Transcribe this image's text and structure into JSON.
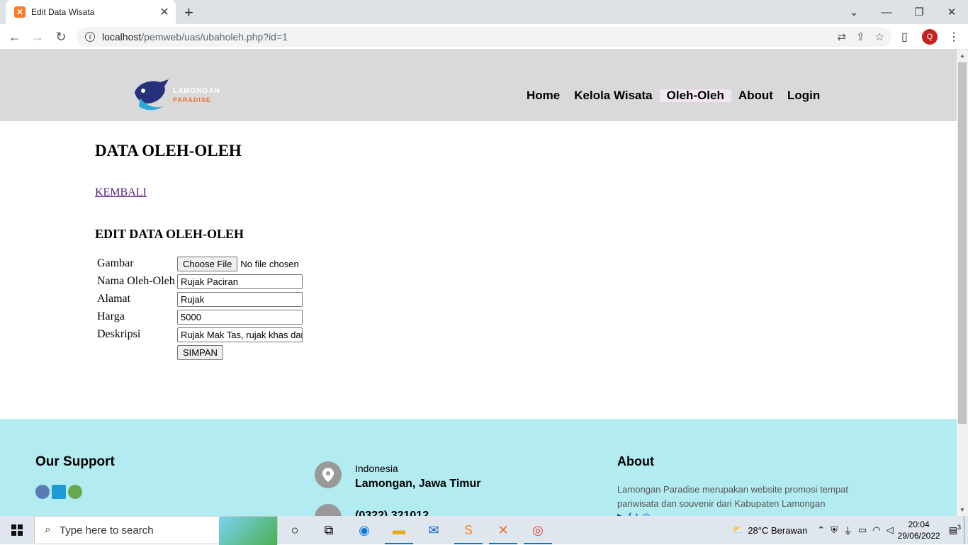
{
  "browser": {
    "tab_title": "Edit Data Wisata",
    "url_host": "localhost",
    "url_path": "/pemweb/uas/ubaholeh.php?id=1",
    "profile_initial": "Q"
  },
  "site": {
    "logo_line1": "LAMONGAN",
    "logo_line2": "PARADISE",
    "nav": [
      "Home",
      "Kelola Wisata",
      "Oleh-Oleh",
      "About",
      "Login"
    ],
    "active_nav": "Oleh-Oleh"
  },
  "page": {
    "heading": "DATA OLEH-OLEH",
    "back_link": "KEMBALI",
    "form_title": "EDIT DATA OLEH-OLEH",
    "form": {
      "gambar_label": "Gambar",
      "file_button": "Choose File",
      "file_status": "No file chosen",
      "nama_label": "Nama Oleh-Oleh",
      "nama_value": "Rujak Paciran",
      "alamat_label": "Alamat",
      "alamat_value": "Rujak",
      "harga_label": "Harga",
      "harga_value": "5000",
      "deskripsi_label": "Deskripsi",
      "deskripsi_value": "Rujak Mak Tas, rujak khas dari Paciran",
      "submit": "SIMPAN"
    }
  },
  "footer": {
    "support_title": "Our Support",
    "country": "Indonesia",
    "city": "Lamongan, Jawa Timur",
    "phone": "(0322) 321012",
    "about_title": "About",
    "about_text": "Lamongan Paradise merupakan website promosi tempat pariwisata dan souvenir dari Kabupaten Lamongan"
  },
  "taskbar": {
    "search_placeholder": "Type here to search",
    "weather": "28°C  Berawan",
    "time": "20:04",
    "date": "29/06/2022",
    "notifications": "3"
  }
}
